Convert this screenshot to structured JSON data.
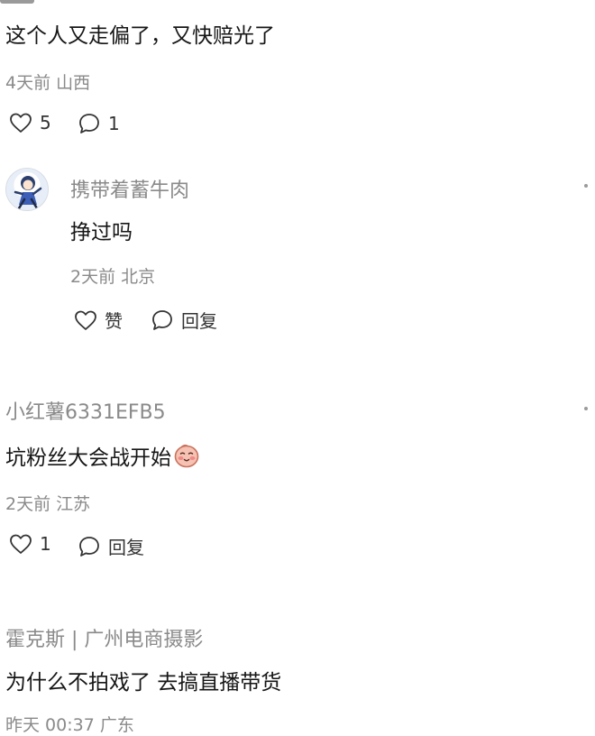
{
  "comments": [
    {
      "text": "这个人又走偏了，又快赔光了",
      "time": "4天前",
      "location": "山西",
      "like_count": "5",
      "reply_count": "1",
      "reply": {
        "username": "携带着蓄牛肉",
        "text": "挣过吗",
        "time": "2天前",
        "location": "北京",
        "like_label": "赞",
        "reply_label": "回复"
      }
    },
    {
      "username": "小红薯6331EFB5",
      "text": "坑粉丝大会战开始",
      "time": "2天前",
      "location": "江苏",
      "like_count": "1",
      "reply_label": "回复"
    },
    {
      "username": "霍克斯 | 广州电商摄影",
      "text": "为什么不拍戏了 去搞直播带货",
      "time": "昨天 00:37",
      "location": "广东"
    }
  ],
  "icons": {
    "like": "heart-outline-icon",
    "comment": "speech-bubble-icon",
    "more": "more-dots-icon",
    "emoji": "blushing-face-emoji"
  },
  "colors": {
    "text": "#161616",
    "meta": "#8a8a8a",
    "icon": "#333333"
  }
}
